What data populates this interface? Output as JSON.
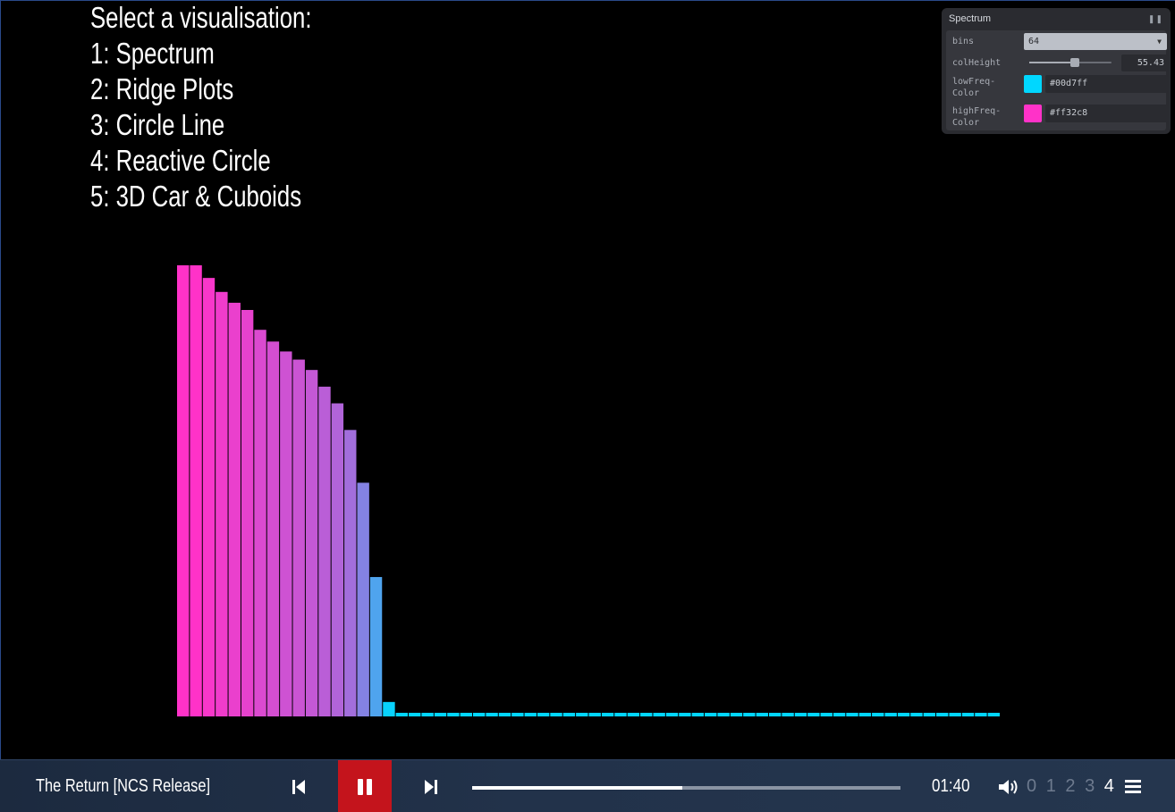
{
  "menu": {
    "title": "Select a visualisation:",
    "items": [
      "1:  Spectrum",
      "2:  Ridge Plots",
      "3:  Circle Line",
      "4:  Reactive Circle",
      "5:  3D Car & Cuboids"
    ]
  },
  "panel": {
    "title": "Spectrum",
    "collapse_icon": "pause-icon",
    "bins_label": "bins",
    "bins_value": "64",
    "colheight_label": "colHeight",
    "colheight_value": "55.43",
    "colheight_fraction": 0.55,
    "lowfreq_label_1": "lowFreq-",
    "lowfreq_label_2": "Color",
    "lowfreq_value": "#00d7ff",
    "highfreq_label_1": "highFreq-",
    "highfreq_label_2": "Color",
    "highfreq_value": "#ff32c8"
  },
  "spectrum": {
    "bins": 64,
    "max_level": 100,
    "levels": [
      100,
      100,
      97.2,
      94.1,
      91.7,
      90.1,
      85.7,
      83.1,
      80.9,
      79.1,
      76.8,
      73.1,
      69.4,
      63.5,
      51.8,
      30.9,
      3.2,
      0.8,
      0.8,
      0.8,
      0.8,
      0.8,
      0.8,
      0.8,
      0.8,
      0.8,
      0.8,
      0.8,
      0.8,
      0.8,
      0.8,
      0.8,
      0.8,
      0.8,
      0.8,
      0.8,
      0.8,
      0.8,
      0.8,
      0.8,
      0.8,
      0.8,
      0.8,
      0.8,
      0.8,
      0.8,
      0.8,
      0.8,
      0.8,
      0.8,
      0.8,
      0.8,
      0.8,
      0.8,
      0.8,
      0.8,
      0.8,
      0.8,
      0.8,
      0.8,
      0.8,
      0.8,
      0.8,
      0.8
    ]
  },
  "player": {
    "track_title": "The Return [NCS Release]",
    "prev_icon": "skip-previous-icon",
    "play_icon": "pause-icon",
    "next_icon": "skip-next-icon",
    "progress_fraction": 0.49,
    "time": "01:40",
    "volume_icon": "volume-icon",
    "volume_levels": [
      "0",
      "1",
      "2",
      "3",
      "4"
    ],
    "volume_active": 4,
    "menu_icon": "hamburger-menu-icon",
    "accent_color": "#c4141c"
  }
}
